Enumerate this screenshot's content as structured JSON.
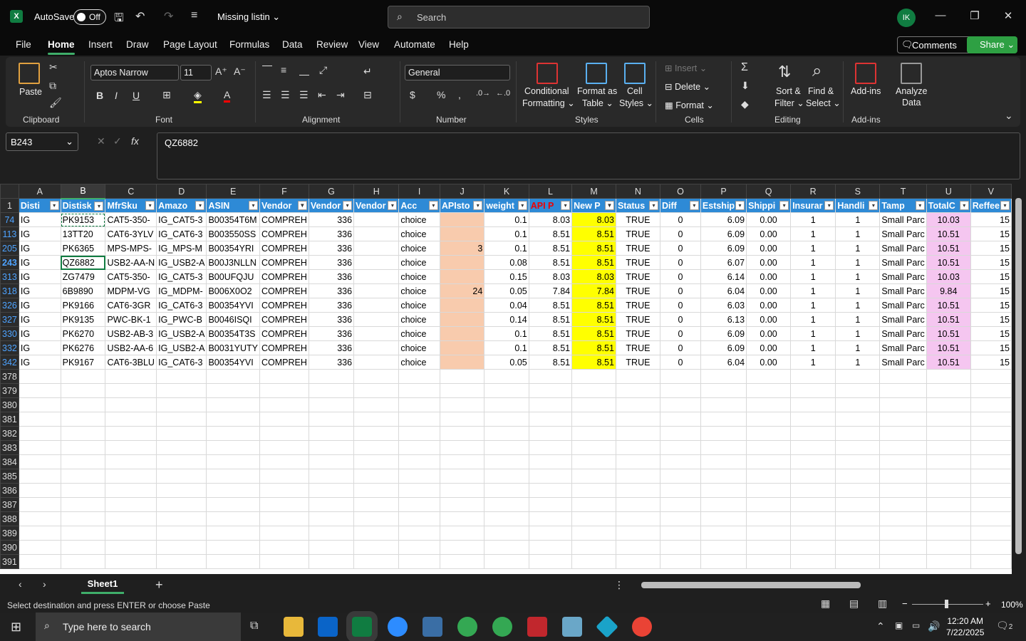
{
  "titlebar": {
    "autosave": "AutoSave",
    "toggle": "Off",
    "filename": "Missing listin",
    "search_placeholder": "Search",
    "avatar": "IK"
  },
  "menu": [
    "File",
    "Home",
    "Insert",
    "Draw",
    "Page Layout",
    "Formulas",
    "Data",
    "Review",
    "View",
    "Automate",
    "Help"
  ],
  "ribbon": {
    "comments": "Comments",
    "share": "Share",
    "paste": "Paste",
    "font_name": "Aptos Narrow",
    "font_size": "11",
    "number_format": "General",
    "conditional": "Conditional",
    "formatting": "Formatting",
    "format_as": "Format as",
    "table": "Table",
    "cell": "Cell",
    "styles_lbl": "Styles",
    "insert": "Insert",
    "delete": "Delete",
    "format": "Format",
    "sort": "Sort &",
    "filter": "Filter",
    "find": "Find &",
    "select": "Select",
    "addins": "Add-ins",
    "analyze": "Analyze",
    "data": "Data",
    "groups": {
      "clipboard": "Clipboard",
      "font": "Font",
      "alignment": "Alignment",
      "number": "Number",
      "styles": "Styles",
      "cells": "Cells",
      "editing": "Editing",
      "addins": "Add-ins"
    }
  },
  "formula": {
    "namebox": "B243",
    "content": "QZ6882"
  },
  "columns": [
    "A",
    "B",
    "C",
    "D",
    "E",
    "F",
    "G",
    "H",
    "I",
    "J",
    "K",
    "L",
    "M",
    "N",
    "O",
    "P",
    "Q",
    "R",
    "S",
    "T",
    "U",
    "V"
  ],
  "headers": [
    "Disti",
    "Distisk",
    "MfrSku",
    "Amazo",
    "ASIN",
    "Vendor",
    "Vendor",
    "Vendor",
    "Acc",
    "APIsto",
    "weight",
    "API P",
    "New P",
    "Status",
    "Diff",
    "Estship",
    "Shippi",
    "Insurar",
    "Handli",
    "Tamp",
    "TotalC",
    "Reffee"
  ],
  "rows": [
    {
      "n": "74",
      "cells": [
        "IG",
        "PK9153",
        "CAT5-350-",
        "IG_CAT5-3",
        "B00354T6M",
        "COMPREH",
        "336",
        "",
        "choice",
        "",
        "0.1",
        "8.03",
        "8.03",
        "TRUE",
        "0",
        "6.09",
        "0.00",
        "1",
        "1",
        "Small Parc",
        "10.03",
        "15"
      ]
    },
    {
      "n": "113",
      "cells": [
        "IG",
        "13TT20",
        "CAT6-3YLV",
        "IG_CAT6-3",
        "B003550SS",
        "COMPREH",
        "336",
        "",
        "choice",
        "",
        "0.1",
        "8.51",
        "8.51",
        "TRUE",
        "0",
        "6.09",
        "0.00",
        "1",
        "1",
        "Small Parc",
        "10.51",
        "15"
      ]
    },
    {
      "n": "205",
      "cells": [
        "IG",
        "PK6365",
        "MPS-MPS-",
        "IG_MPS-M",
        "B00354YRI",
        "COMPREH",
        "336",
        "",
        "choice",
        "3",
        "0.1",
        "8.51",
        "8.51",
        "TRUE",
        "0",
        "6.09",
        "0.00",
        "1",
        "1",
        "Small Parc",
        "10.51",
        "15"
      ]
    },
    {
      "n": "243",
      "cells": [
        "IG",
        "QZ6882",
        "USB2-AA-N",
        "IG_USB2-A",
        "B00J3NLLN",
        "COMPREH",
        "336",
        "",
        "choice",
        "",
        "0.08",
        "8.51",
        "8.51",
        "TRUE",
        "0",
        "6.07",
        "0.00",
        "1",
        "1",
        "Small Parc",
        "10.51",
        "15"
      ]
    },
    {
      "n": "313",
      "cells": [
        "IG",
        "ZG7479",
        "CAT5-350-",
        "IG_CAT5-3",
        "B00UFQJU",
        "COMPREH",
        "336",
        "",
        "choice",
        "",
        "0.15",
        "8.03",
        "8.03",
        "TRUE",
        "0",
        "6.14",
        "0.00",
        "1",
        "1",
        "Small Parc",
        "10.03",
        "15"
      ]
    },
    {
      "n": "318",
      "cells": [
        "IG",
        "6B9890",
        "MDPM-VG",
        "IG_MDPM-",
        "B006X0O2",
        "COMPREH",
        "336",
        "",
        "choice",
        "24",
        "0.05",
        "7.84",
        "7.84",
        "TRUE",
        "0",
        "6.04",
        "0.00",
        "1",
        "1",
        "Small Parc",
        "9.84",
        "15"
      ]
    },
    {
      "n": "326",
      "cells": [
        "IG",
        "PK9166",
        "CAT6-3GR",
        "IG_CAT6-3",
        "B00354YVI",
        "COMPREH",
        "336",
        "",
        "choice",
        "",
        "0.04",
        "8.51",
        "8.51",
        "TRUE",
        "0",
        "6.03",
        "0.00",
        "1",
        "1",
        "Small Parc",
        "10.51",
        "15"
      ]
    },
    {
      "n": "327",
      "cells": [
        "IG",
        "PK9135",
        "PWC-BK-1",
        "IG_PWC-B",
        "B0046ISQI",
        "COMPREH",
        "336",
        "",
        "choice",
        "",
        "0.14",
        "8.51",
        "8.51",
        "TRUE",
        "0",
        "6.13",
        "0.00",
        "1",
        "1",
        "Small Parc",
        "10.51",
        "15"
      ]
    },
    {
      "n": "330",
      "cells": [
        "IG",
        "PK6270",
        "USB2-AB-3",
        "IG_USB2-A",
        "B00354T3S",
        "COMPREH",
        "336",
        "",
        "choice",
        "",
        "0.1",
        "8.51",
        "8.51",
        "TRUE",
        "0",
        "6.09",
        "0.00",
        "1",
        "1",
        "Small Parc",
        "10.51",
        "15"
      ]
    },
    {
      "n": "332",
      "cells": [
        "IG",
        "PK6276",
        "USB2-AA-6",
        "IG_USB2-A",
        "B0031YUTY",
        "COMPREH",
        "336",
        "",
        "choice",
        "",
        "0.1",
        "8.51",
        "8.51",
        "TRUE",
        "0",
        "6.09",
        "0.00",
        "1",
        "1",
        "Small Parc",
        "10.51",
        "15"
      ]
    },
    {
      "n": "342",
      "cells": [
        "IG",
        "PK9167",
        "CAT6-3BLU",
        "IG_CAT6-3",
        "B00354YVI",
        "COMPREH",
        "336",
        "",
        "choice",
        "",
        "0.05",
        "8.51",
        "8.51",
        "TRUE",
        "0",
        "6.04",
        "0.00",
        "1",
        "1",
        "Small Parc",
        "10.51",
        "15"
      ]
    }
  ],
  "empty_rows": [
    "378",
    "379",
    "380",
    "381",
    "382",
    "383",
    "384",
    "385",
    "386",
    "387",
    "388",
    "389",
    "390",
    "391"
  ],
  "sheet": {
    "name": "Sheet1"
  },
  "status": {
    "message": "Select destination and press ENTER or choose Paste",
    "zoom": "100%"
  },
  "taskbar": {
    "search": "Type here to search",
    "time": "12:20 AM",
    "date": "7/22/2025",
    "notif": "2"
  }
}
